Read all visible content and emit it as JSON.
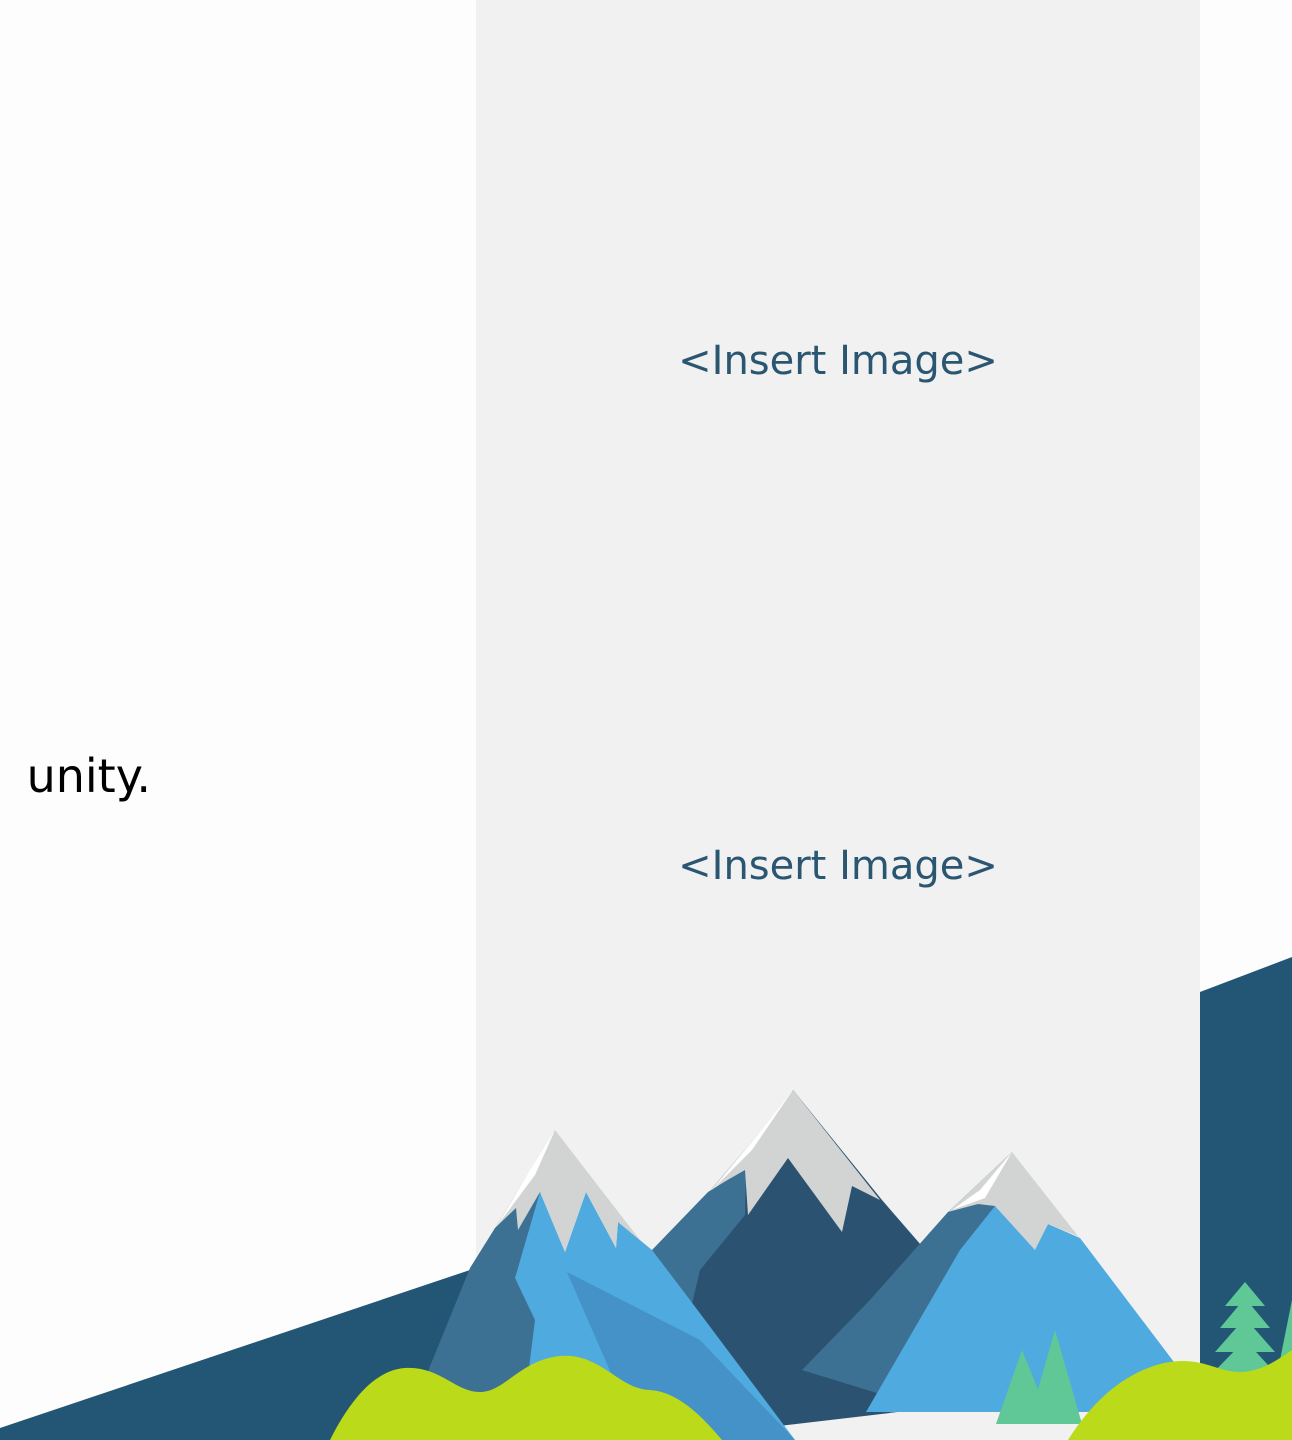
{
  "slide": {
    "body_text": "unity.",
    "image_placeholders": [
      "<Insert Image>",
      "<Insert Image>"
    ]
  },
  "colors": {
    "panel_background": "#f1f1f1",
    "placeholder_text": "#2a5672",
    "dark_band": "#235675",
    "mountain_dark": "#2b5271",
    "mountain_mid": "#3d7193",
    "mountain_light": "#4faadf",
    "snow_cap": "#d2d4d3",
    "hill_green": "#bada1a",
    "tree_green": "#5fc896"
  },
  "icons": {
    "decoration": "mountain-landscape-illustration"
  }
}
